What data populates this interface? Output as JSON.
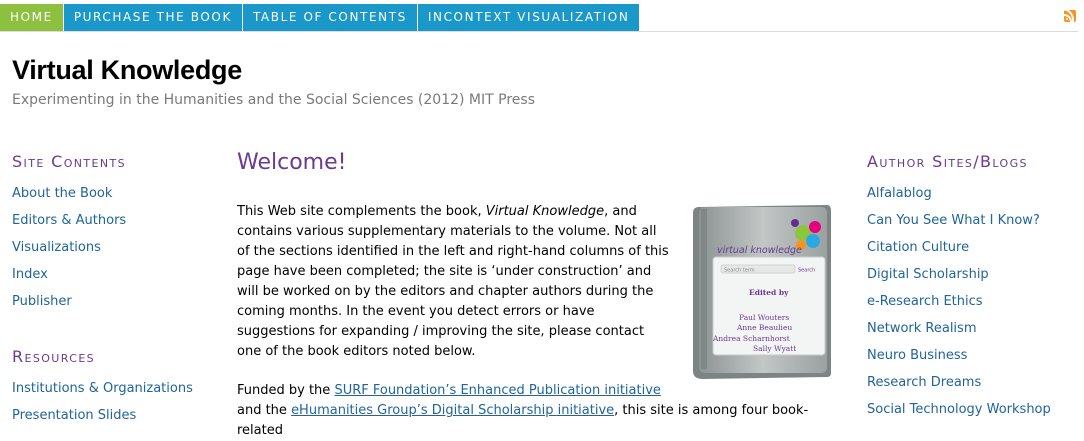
{
  "nav": {
    "items": [
      {
        "label": "HOME",
        "active": true
      },
      {
        "label": "PURCHASE THE BOOK",
        "active": false
      },
      {
        "label": "TABLE OF CONTENTS",
        "active": false
      },
      {
        "label": "INCONTEXT VISUALIZATION",
        "active": false
      }
    ],
    "active_color": "#8dc03f",
    "color": "#1a98c9",
    "rss_icon": "rss-feed-icon"
  },
  "site": {
    "title": "Virtual Knowledge",
    "subtitle": "Experimenting in the Humanities and the Social Sciences (2012) MIT Press"
  },
  "left": {
    "contents_heading": "Site Contents",
    "contents": [
      "About the Book",
      "Editors & Authors",
      "Visualizations",
      "Index",
      "Publisher"
    ],
    "resources_heading": "Resources",
    "resources": [
      "Institutions & Organizations",
      "Presentation Slides"
    ]
  },
  "right": {
    "heading": "Author Sites/Blogs",
    "links": [
      "Alfalablog",
      "Can You See What I Know?",
      "Citation Culture",
      "Digital Scholarship",
      "e-Research Ethics",
      "Network Realism",
      "Neuro Business",
      "Research Dreams",
      "Social Technology Workshop"
    ]
  },
  "main": {
    "heading": "Welcome!",
    "p1_pre": "This Web site complements the book, ",
    "p1_em": "Virtual Knowledge",
    "p1_post": ", and contains various supplementary materials to the volume. Not all of the sections identified in the left and right-hand columns of this page have been completed; the site is ‘under construction’ and will be worked on by the editors and chapter authors during the coming months. In the event you detect errors or have suggestions for expanding / improving the site, please contact one of the book editors noted below.",
    "p2_a": "Funded by the ",
    "p2_link1": "SURF Foundation’s Enhanced Publication initiative",
    "p2_b": "and the ",
    "p2_link2": "eHumanities Group’s Digital Scholarship initiative",
    "p2_c": ", this site is among four book-related"
  },
  "book": {
    "title": "virtual knowledge",
    "search_placeholder": "Search term",
    "search_label": "Search",
    "edited_by": "Edited by",
    "editors": [
      "Paul Wouters",
      "Anne Beaulieu",
      "Andrea Scharnhorst",
      "Sally Wyatt"
    ]
  }
}
